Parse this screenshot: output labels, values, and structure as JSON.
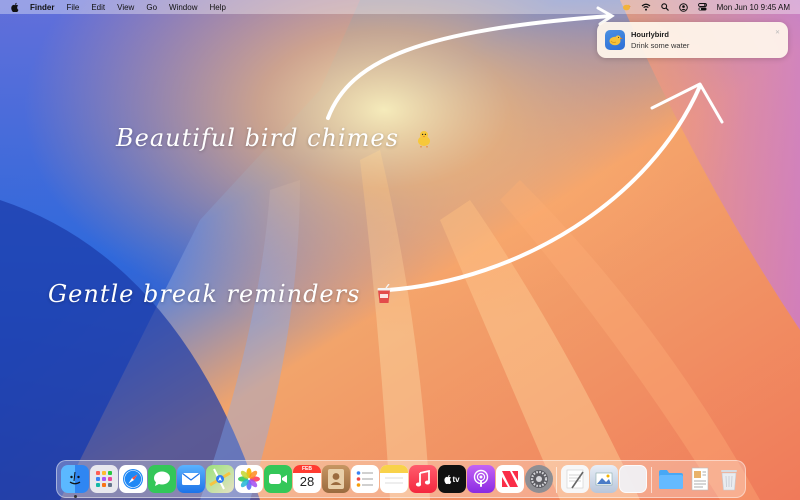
{
  "menubar": {
    "app_name": "Finder",
    "menus": [
      "File",
      "Edit",
      "View",
      "Go",
      "Window",
      "Help"
    ],
    "clock": "Mon Jun 10  9:45 AM"
  },
  "notification": {
    "app_title": "Hourlybird",
    "message": "Drink some water"
  },
  "captions": {
    "line1": "Beautiful bird chimes",
    "line2": "Gentle break reminders"
  },
  "dock": {
    "calendar": {
      "month": "FEB",
      "day": "28"
    },
    "tv_label": "tv",
    "items": [
      "finder",
      "launchpad",
      "safari",
      "messages",
      "mail",
      "maps",
      "photos",
      "facetime",
      "calendar",
      "contacts",
      "reminders",
      "notes",
      "music",
      "tv",
      "podcasts",
      "news",
      "system-settings",
      "textedit",
      "preview",
      "blank-window",
      "folder",
      "document",
      "trash"
    ]
  },
  "colors": {
    "menubar_bg": "#ffffff",
    "notification_bg": "#fff6ec",
    "caption_text": "#ffffff"
  }
}
